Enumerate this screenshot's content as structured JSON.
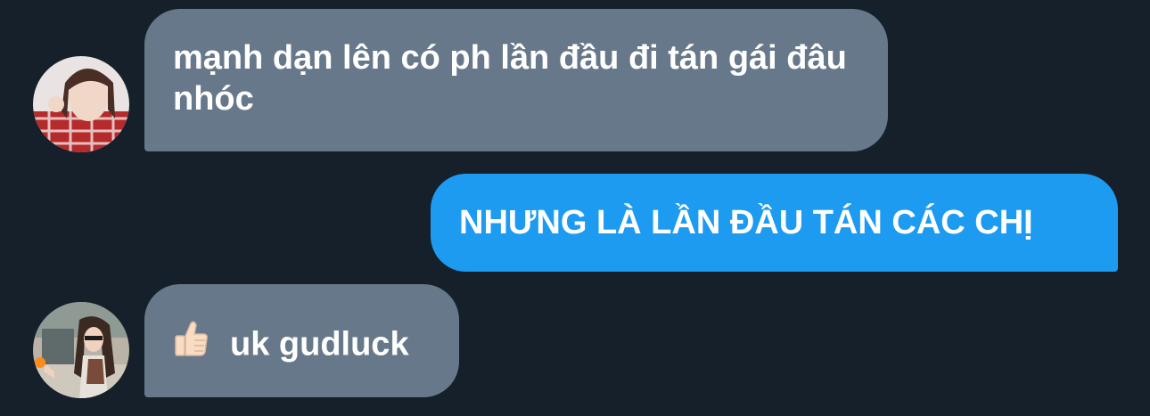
{
  "conversation": {
    "messages": [
      {
        "direction": "incoming",
        "text": "mạnh dạn lên có ph lần đầu đi tán gái đâu nhóc",
        "avatar_icon": "user-avatar-icon"
      },
      {
        "direction": "outgoing",
        "text": "NHƯNG LÀ LẦN ĐẦU TÁN CÁC CHỊ"
      },
      {
        "direction": "incoming",
        "emoji": "thumbs-up-icon",
        "text": "uk gudluck",
        "avatar_icon": "user-avatar-icon"
      }
    ]
  },
  "colors": {
    "background": "#15202b",
    "incoming_bubble": "#66788a",
    "outgoing_bubble": "#1d9bf0",
    "text": "#ffffff"
  }
}
